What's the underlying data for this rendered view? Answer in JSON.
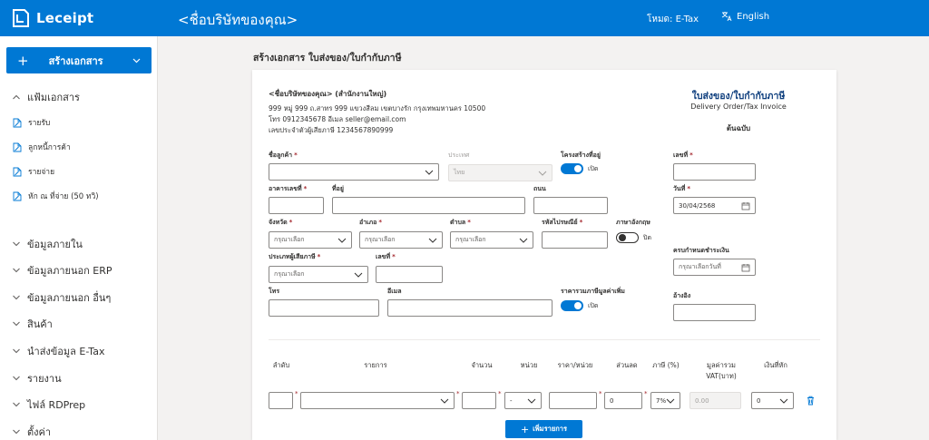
{
  "header": {
    "app_name": "Leceipt",
    "company_title": "<ชื่อบริษัทของคุณ>",
    "mode_label": "โหมด: E-Tax",
    "language": "English"
  },
  "sidebar": {
    "create_button": "สร้างเอกสาร",
    "documents_group": "แฟ้มเอกสาร",
    "document_items": [
      "รายรับ",
      "ลูกหนี้การค้า",
      "รายจ่าย",
      "หัก ณ ที่จ่าย (50 ทวิ)"
    ],
    "groups": [
      "ข้อมูลภายใน",
      "ข้อมูลภายนอก ERP",
      "ข้อมูลภายนอก อื่นๆ",
      "สินค้า",
      "นำส่งข้อมูล E-Tax",
      "รายงาน",
      "ไฟล์ RDPrep",
      "ตั้งค่า"
    ]
  },
  "page": {
    "title": "สร้างเอกสาร ใบส่งของ/ใบกำกับภาษี"
  },
  "company": {
    "name": "<ชื่อบริษัทของคุณ> (สำนักงานใหญ่)",
    "address": "999 หมู่ 999 ถ.สาทร 999 แขวงสีลม เขตบางรัก กรุงเทพมหานคร 10500",
    "contact": "โทร 0912345678 อีเมล seller@email.com",
    "tax_id": "เลขประจำตัวผู้เสียภาษี 1234567890999"
  },
  "document": {
    "title": "ใบส่งของ/ใบกำกับภาษี",
    "subtitle": "Delivery Order/Tax Invoice",
    "original": "ต้นฉบับ"
  },
  "form": {
    "customer_name_label": "ชื่อลูกค้า",
    "country_label": "ประเทศ",
    "country_value": "ไทย",
    "address_structure_label": "โครงสร้างที่อยู่",
    "address_structure_state": "เปิด",
    "building_no_label": "อาคารเลขที่",
    "address_label": "ที่อยู่",
    "road_label": "ถนน",
    "province_label": "จังหวัด",
    "district_label": "อำเภอ",
    "subdistrict_label": "ตำบล",
    "postcode_label": "รหัสไปรษณีย์",
    "english_label": "ภาษาอังกฤษ",
    "english_state": "ปิด",
    "select_placeholder": "กรุณาเลือก",
    "taxpayer_type_label": "ประเภทผู้เสียภาษี",
    "tax_number_label": "เลขที่",
    "phone_label": "โทร",
    "email_label": "อีเมล",
    "vat_included_label": "ราคารวมภาษีมูลค่าเพิ่ม",
    "vat_included_state": "เปิด",
    "doc_number_label": "เลขที่",
    "date_label": "วันที่",
    "date_value": "30/04/2568",
    "due_date_label": "ครบกำหนดชำระเงิน",
    "due_date_placeholder": "กรุณาเลือกวันที่",
    "reference_label": "อ้างอิง"
  },
  "items_table": {
    "headers": [
      "ลำดับ",
      "รายการ",
      "จำนวน",
      "หน่วย",
      "ราคา/หน่วย",
      "ส่วนลด",
      "ภาษี (%)",
      "มูลค่ารวม VAT(บาท)",
      "เงินที่หัก"
    ],
    "row": {
      "unit": "-",
      "discount": "0",
      "vat": "7%",
      "total": "0.00",
      "withholding": "0"
    },
    "add_button": "เพิ่มรายการ"
  }
}
